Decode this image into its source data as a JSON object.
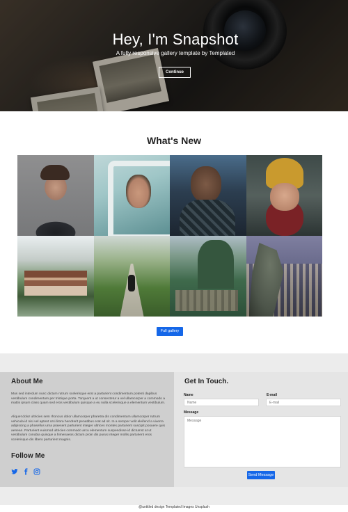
{
  "hero": {
    "title": "Hey, I'm Snapshot",
    "subtitle": "A fully responsive gallery template by Templated",
    "button_label": "Continue"
  },
  "whats_new": {
    "title": "What's New",
    "gallery": [
      {
        "name": "gallery-photo-man-portrait"
      },
      {
        "name": "gallery-photo-woman-in-van"
      },
      {
        "name": "gallery-photo-man-sunglasses"
      },
      {
        "name": "gallery-photo-woman-beanie"
      },
      {
        "name": "gallery-photo-pagoda"
      },
      {
        "name": "gallery-photo-lantern-path"
      },
      {
        "name": "gallery-photo-mountain-ruins"
      },
      {
        "name": "gallery-photo-gargoyle-city"
      }
    ],
    "full_gallery_label": "Full gallery"
  },
  "about": {
    "title": "About Me",
    "p1": "Mus sed interdum nunc dictum rutrum scelerisque erat a parturient condimentum potenti dapibus vestibulum condimentum per tristique porta. Torquent a ut consectetur a vel ullamcorper a commodo a mattis ipsum class quam sed eros vestibulum quisque a eu nulla scelerisque a elementum vestibulum.",
    "p2": "Aliquet dolor ultricies sem rhoncus dolor ullamcorper pharetra dis condimentum ullamcorper rutrum vehicula id nisi vel aptent orci litora hendrerit penatibus erat ad sit. In a semper velit eleifend a viverra adipiscing a phasellus urna praesent parturient integer ultrices montes parturient suscipit posuere quis aenean. Parturient euismod ultricies commodo arcu elementum suspendisse id dictumst at ut vestibulum conubia quisque a himenaeos dictum proin dis purus integer mollis parturient eros scelerisque dis libero parturient magnis.",
    "follow_title": "Follow Me",
    "social": [
      "twitter-icon",
      "facebook-icon",
      "instagram-icon"
    ]
  },
  "contact": {
    "title": "Get In Touch.",
    "name_label": "Name",
    "name_placeholder": "Name",
    "email_label": "E-mail",
    "email_placeholder": "E-mail",
    "message_label": "Message",
    "message_placeholder": "Message",
    "send_label": "Send Message"
  },
  "footer": {
    "copyright": "@untitled design Templated Images Unsplash"
  },
  "colors": {
    "accent": "#1567e8",
    "about_bg": "#cfcfcf",
    "contact_bg": "#e5e5e5"
  }
}
